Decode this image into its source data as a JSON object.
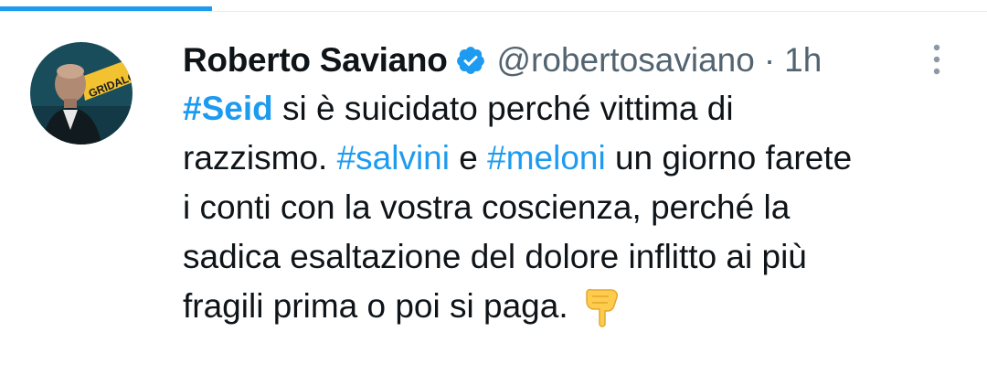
{
  "progress": {
    "fraction": 0.215,
    "color": "#1d9bf0"
  },
  "tweet": {
    "display_name": "Roberto Saviano",
    "verified": true,
    "handle": "@robertosaviano",
    "separator": "·",
    "time": "1h",
    "avatar_text": "GRIDALO",
    "lines": [
      [
        {
          "text": "#Seid",
          "type": "hashtag-bold"
        },
        {
          "text": " si è suicidato perché vittima di",
          "type": "text"
        }
      ],
      [
        {
          "text": "razzismo. ",
          "type": "text"
        },
        {
          "text": "#salvini",
          "type": "hashtag"
        },
        {
          "text": " e ",
          "type": "text"
        },
        {
          "text": "#meloni",
          "type": "hashtag"
        },
        {
          "text": " un giorno farete",
          "type": "text"
        }
      ],
      [
        {
          "text": "i conti con la vostra coscienza, perché la",
          "type": "text"
        }
      ],
      [
        {
          "text": "sadica esaltazione del dolore inflitto ai più",
          "type": "text"
        }
      ],
      [
        {
          "text": "fragili prima o poi si paga.",
          "type": "text"
        }
      ]
    ],
    "trailing_icon": "pointing-down-hand-icon"
  },
  "colors": {
    "accent": "#1d9bf0",
    "text": "#0f1419",
    "secondary": "#536471",
    "avatar_bg": "#1a4d5c",
    "avatar_banner": "#f2c230"
  },
  "icons": {
    "verified": "verified-badge-icon",
    "more": "more-options-icon"
  }
}
